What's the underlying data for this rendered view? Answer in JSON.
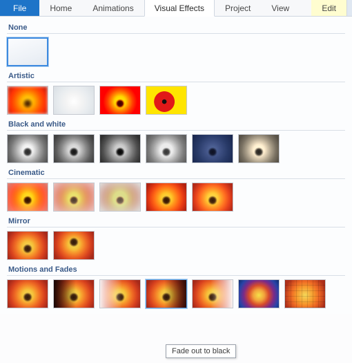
{
  "ribbon": {
    "tabs": [
      {
        "label": "File",
        "kind": "file"
      },
      {
        "label": "Home",
        "kind": "normal"
      },
      {
        "label": "Animations",
        "kind": "normal"
      },
      {
        "label": "Visual Effects",
        "kind": "active"
      },
      {
        "label": "Project",
        "kind": "normal"
      },
      {
        "label": "View",
        "kind": "normal"
      },
      {
        "label": "Edit",
        "kind": "edit"
      }
    ]
  },
  "groups": {
    "none": {
      "label": "None"
    },
    "artistic": {
      "label": "Artistic"
    },
    "bw": {
      "label": "Black and white"
    },
    "cinematic": {
      "label": "Cinematic"
    },
    "mirror": {
      "label": "Mirror"
    },
    "motions": {
      "label": "Motions and Fades"
    }
  },
  "tooltip": {
    "text": "Fade out to black"
  }
}
